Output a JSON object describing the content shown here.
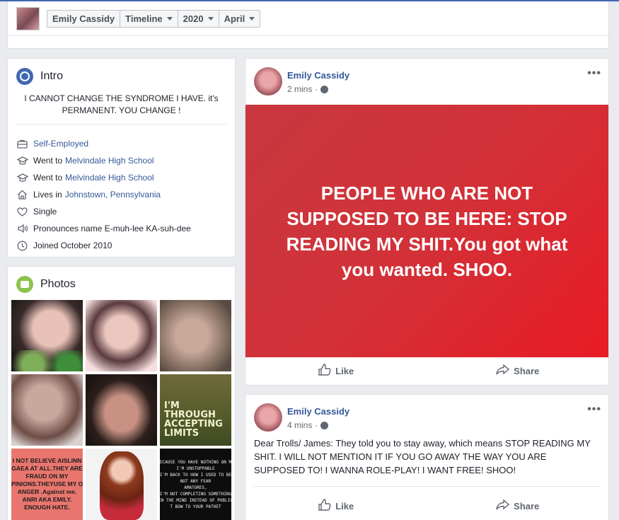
{
  "header": {
    "name": "Emily Cassidy",
    "crumbs": [
      "Timeline",
      "2020",
      "April"
    ]
  },
  "intro": {
    "title": "Intro",
    "bio": "I CANNOT CHANGE THE SYNDROME I HAVE. it's PERMANENT. YOU CHANGE !",
    "facts": [
      {
        "icon": "briefcase-icon",
        "prefix": "",
        "link": "Self-Employed"
      },
      {
        "icon": "graduation-cap-icon",
        "prefix": "Went to",
        "link": "Melvindale High School"
      },
      {
        "icon": "graduation-cap-icon",
        "prefix": "Went to",
        "link": "Melvindale High School"
      },
      {
        "icon": "home-icon",
        "prefix": "Lives in",
        "link": "Johnstown, Pennsylvania"
      },
      {
        "icon": "heart-icon",
        "prefix": "Single",
        "link": ""
      },
      {
        "icon": "speaker-icon",
        "prefix": "Pronounces name E-muh-lee KA-suh-dee",
        "link": ""
      },
      {
        "icon": "clock-icon",
        "prefix": "Joined October 2010",
        "link": ""
      }
    ]
  },
  "photos": {
    "title": "Photos",
    "texts": {
      "p6": "I'M\nTHROUGH\nACCEPTING\nLIMITS",
      "p7": "I NOT BELIEVE AISLINN\nGAEA AT ALL.THEY ARE\nFRAUD ON MY\nPINIONS.THEYUSE MY O\nANGER .Against me.\nANRI AKA EMILY.\nENOUGH HATE.",
      "p9": "BECAUSE YOU HAVE NOTHING ON ME\nI'M UNSTOPPABLE\nI'M BACK TO HOW I USED TO BE\nNOT ANY FEAR\nAMATURES,\nI'M NOT COMPLETING SOMETHING\nIN THE MIND INSTEAD OF PUBLIC\nT BOW TO YOUR PATHET"
    }
  },
  "posts": [
    {
      "author": "Emily Cassidy",
      "time": "2 mins",
      "banner_text": "PEOPLE WHO ARE NOT SUPPOSED TO BE HERE: STOP READING MY SHIT.You got what you wanted. SHOO.",
      "like": "Like",
      "share": "Share"
    },
    {
      "author": "Emily Cassidy",
      "time": "4 mins",
      "text": "Dear Trolls/ James: They told you to stay away, which means STOP READING MY SHIT. I WILL NOT MENTION IT IF YOU GO AWAY THE WAY YOU ARE SUPPOSED TO! I WANNA ROLE-PLAY! I WANT FREE! SHOO!",
      "like": "Like",
      "share": "Share"
    }
  ],
  "more_glyph": "•••",
  "colors": {
    "link": "#365899",
    "banner": "#d23138",
    "accent": "#4267b2"
  }
}
